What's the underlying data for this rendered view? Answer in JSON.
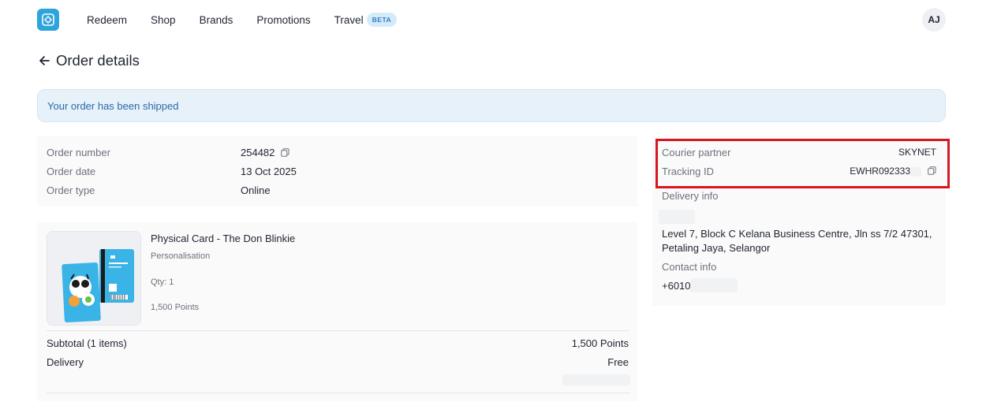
{
  "header": {
    "nav": [
      "Redeem",
      "Shop",
      "Brands",
      "Promotions",
      "Travel"
    ],
    "beta_badge": "BETA",
    "avatar_initials": "AJ"
  },
  "page": {
    "title": "Order details",
    "status_banner": "Your order has been shipped"
  },
  "order_info": {
    "number_label": "Order number",
    "number": "254482",
    "date_label": "Order date",
    "date": "13 Oct 2025",
    "type_label": "Order type",
    "type": "Online"
  },
  "item": {
    "name": "Physical Card - The Don Blinkie",
    "option": "Personalisation",
    "qty": "Qty: 1",
    "points": "1,500 Points"
  },
  "summary": {
    "subtotal_label": "Subtotal (1 items)",
    "subtotal_value": "1,500 Points",
    "delivery_label": "Delivery",
    "delivery_value": "Free"
  },
  "shipping": {
    "courier_label": "Courier partner",
    "courier": "SKYNET",
    "tracking_label": "Tracking ID",
    "tracking_id": "EWHR092333",
    "delivery_info_label": "Delivery info",
    "address_line1": "Level 7, Block C Kelana Business Centre, Jln ss 7/2 47301,",
    "address_line2": "Petaling Jaya, Selangor",
    "contact_label": "Contact info",
    "phone": "+6010"
  },
  "colors": {
    "accent": "#2ea4dc",
    "banner_bg": "#e6f1fa",
    "banner_text": "#2b6aa5",
    "highlight": "#d7171f"
  }
}
